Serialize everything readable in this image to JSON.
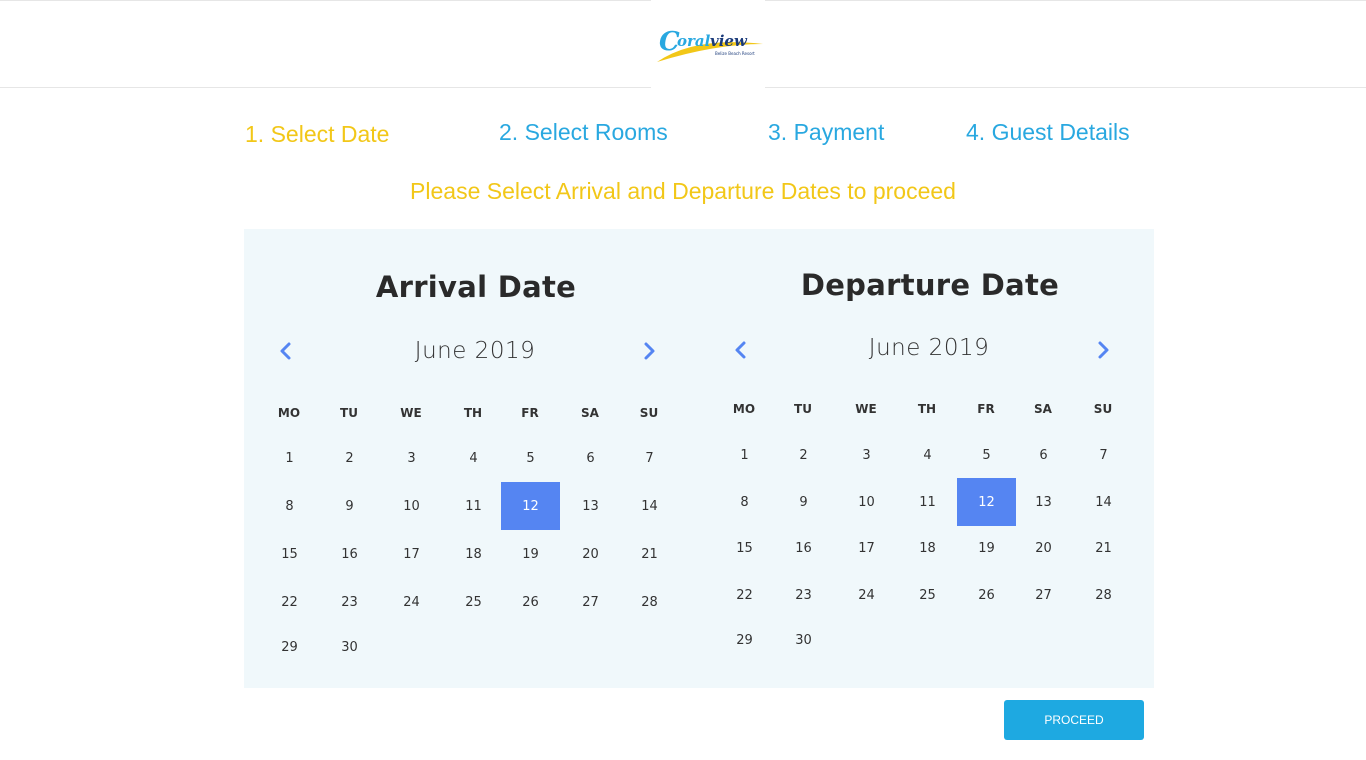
{
  "header": {
    "logo_text": "Coralview",
    "logo_tagline": "Belize Beach Resort"
  },
  "steps": [
    {
      "label": "1. Select Date",
      "state": "active"
    },
    {
      "label": "2. Select Rooms",
      "state": "todo"
    },
    {
      "label": "3. Payment",
      "state": "todo"
    },
    {
      "label": "4. Guest Details",
      "state": "todo"
    }
  ],
  "prompt": "Please Select Arrival and Departure Dates to proceed",
  "colors": {
    "accent_yellow": "#f2c718",
    "accent_blue": "#29a8e0",
    "selected_day": "#5585f2",
    "button": "#1ea9e1",
    "panel_bg": "#f0f8fb"
  },
  "weekdays": [
    "MO",
    "TU",
    "WE",
    "TH",
    "FR",
    "SA",
    "SU"
  ],
  "arrival": {
    "title": "Arrival Date",
    "month": "June 2019",
    "prev_icon": "chevron-left-icon",
    "next_icon": "chevron-right-icon",
    "days": [
      "1",
      "2",
      "3",
      "4",
      "5",
      "6",
      "7",
      "8",
      "9",
      "10",
      "11",
      "12",
      "13",
      "14",
      "15",
      "16",
      "17",
      "18",
      "19",
      "20",
      "21",
      "22",
      "23",
      "24",
      "25",
      "26",
      "27",
      "28",
      "29",
      "30"
    ],
    "selected": "12"
  },
  "departure": {
    "title": "Departure Date",
    "month": "June 2019",
    "prev_icon": "chevron-left-icon",
    "next_icon": "chevron-right-icon",
    "days": [
      "1",
      "2",
      "3",
      "4",
      "5",
      "6",
      "7",
      "8",
      "9",
      "10",
      "11",
      "12",
      "13",
      "14",
      "15",
      "16",
      "17",
      "18",
      "19",
      "20",
      "21",
      "22",
      "23",
      "24",
      "25",
      "26",
      "27",
      "28",
      "29",
      "30"
    ],
    "selected": "12"
  },
  "proceed_label": "PROCEED"
}
